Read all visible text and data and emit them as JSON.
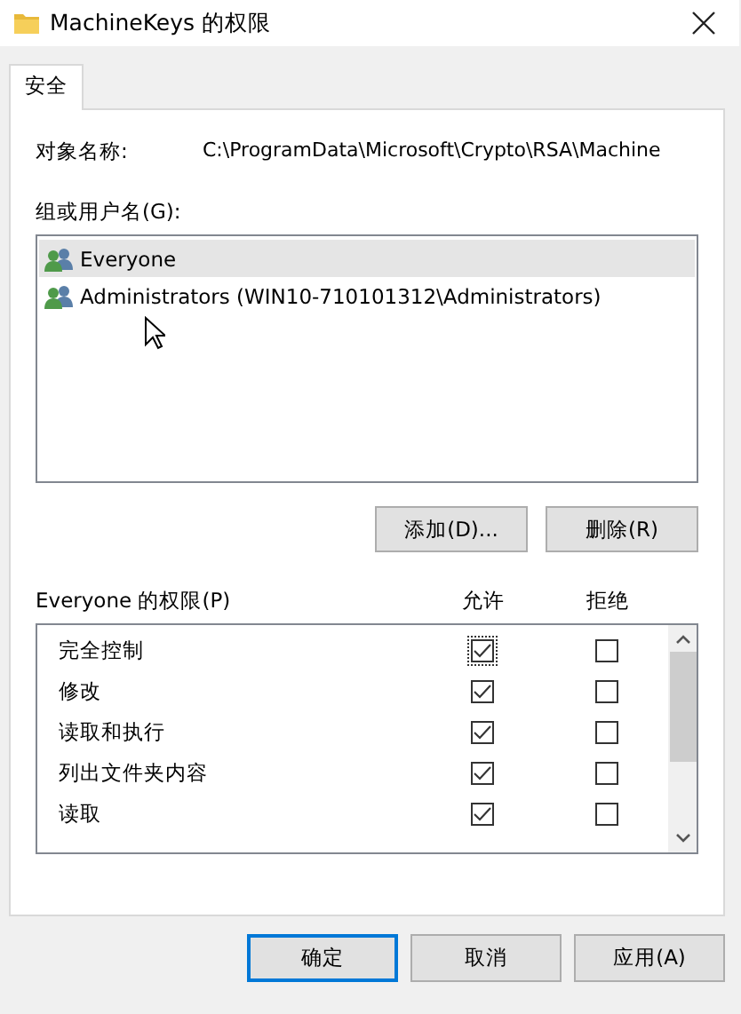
{
  "window": {
    "title": "MachineKeys 的权限"
  },
  "tabs": [
    {
      "label": "安全",
      "selected": true
    }
  ],
  "object_name": {
    "label": "对象名称:",
    "value": "C:\\ProgramData\\Microsoft\\Crypto\\RSA\\Machine"
  },
  "users": {
    "label": "组或用户名(G):",
    "items": [
      {
        "name": "Everyone",
        "selected": true
      },
      {
        "name": "Administrators (WIN10-710101312\\Administrators)",
        "selected": false
      }
    ]
  },
  "user_buttons": [
    "添加(D)...",
    "删除(R)"
  ],
  "permissions": {
    "label": "Everyone 的权限(P)",
    "allow_header": "允许",
    "deny_header": "拒绝",
    "rows": [
      {
        "name": "完全控制",
        "allow": true,
        "deny": false,
        "focused": true
      },
      {
        "name": "修改",
        "allow": true,
        "deny": false,
        "focused": false
      },
      {
        "name": "读取和执行",
        "allow": true,
        "deny": false,
        "focused": false
      },
      {
        "name": "列出文件夹内容",
        "allow": true,
        "deny": false,
        "focused": false
      },
      {
        "name": "读取",
        "allow": true,
        "deny": false,
        "focused": false
      }
    ]
  },
  "buttons": [
    {
      "label": "确定",
      "default": true
    },
    {
      "label": "取消",
      "default": false
    },
    {
      "label": "应用(A)",
      "default": false
    }
  ]
}
